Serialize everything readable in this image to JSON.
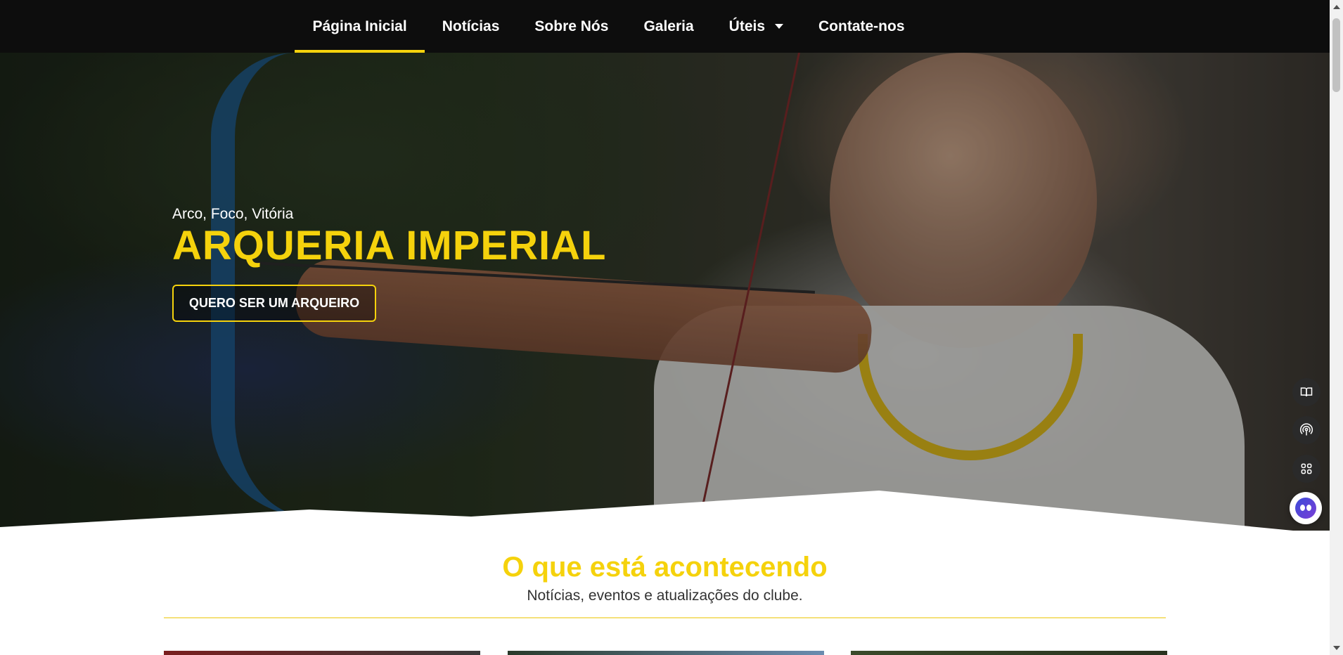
{
  "nav": {
    "items": [
      {
        "label": "Página Inicial",
        "active": true
      },
      {
        "label": "Notícias"
      },
      {
        "label": "Sobre Nós"
      },
      {
        "label": "Galeria"
      },
      {
        "label": "Úteis",
        "has_dropdown": true
      },
      {
        "label": "Contate-nos"
      }
    ]
  },
  "hero": {
    "tagline": "Arco, Foco, Vitória",
    "title": "ARQUERIA IMPERIAL",
    "cta_label": "QUERO SER UM ARQUEIRO"
  },
  "section": {
    "title": "O que está acontecendo",
    "subtitle": "Notícias, eventos e atualizações do clube."
  },
  "side_widgets": [
    "book-icon",
    "podcast-icon",
    "apps-icon",
    "assistant-bot-icon"
  ],
  "colors": {
    "accent": "#f5d20c",
    "nav_bg": "#0d0d0d",
    "text_dark": "#333333"
  }
}
